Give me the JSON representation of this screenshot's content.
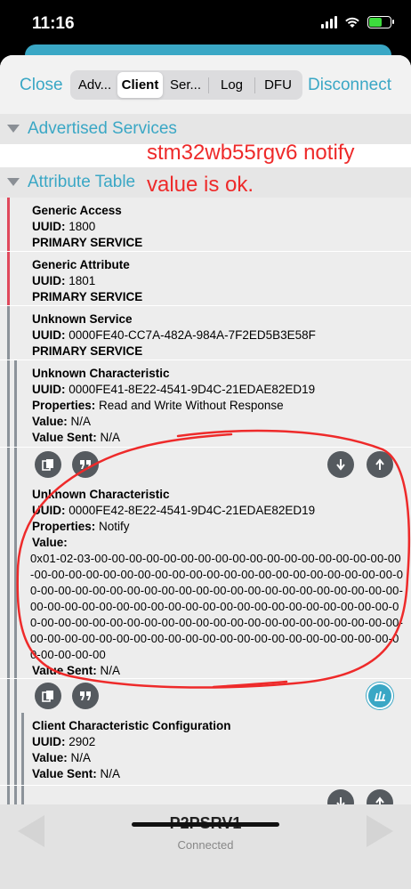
{
  "status_bar": {
    "time": "11:16"
  },
  "topbar": {
    "close_label": "Close",
    "disconnect_label": "Disconnect",
    "tabs": [
      {
        "label": "Adv..."
      },
      {
        "label": "Client"
      },
      {
        "label": "Ser..."
      },
      {
        "label": "Log"
      },
      {
        "label": "DFU"
      }
    ],
    "active_tab": "Client"
  },
  "sections": {
    "advertised": "Advertised Services",
    "attribute_table": "Attribute Table"
  },
  "annotation": {
    "line1": "stm32wb55rgv6 notify",
    "line2": "value is ok."
  },
  "rows": [
    {
      "name": "Generic Access",
      "uuid_label": "UUID:",
      "uuid": "1800",
      "kind": "PRIMARY SERVICE"
    },
    {
      "name": "Generic Attribute",
      "uuid_label": "UUID:",
      "uuid": "1801",
      "kind": "PRIMARY SERVICE"
    },
    {
      "name": "Unknown Service",
      "uuid_label": "UUID:",
      "uuid": "0000FE40-CC7A-482A-984A-7F2ED5B3E58F",
      "kind": "PRIMARY SERVICE"
    },
    {
      "name": "Unknown Characteristic",
      "uuid_label": "UUID:",
      "uuid": "0000FE41-8E22-4541-9D4C-21EDAE82ED19",
      "props_label": "Properties:",
      "props": "Read and Write Without Response",
      "value_label": "Value:",
      "value": "N/A",
      "sent_label": "Value Sent:",
      "sent": "N/A"
    },
    {
      "name": "Unknown Characteristic",
      "uuid_label": "UUID:",
      "uuid": "0000FE42-8E22-4541-9D4C-21EDAE82ED19",
      "props_label": "Properties:",
      "props": "Notify",
      "value_label": "Value:",
      "value": "0x01-02-03-00-00-00-00-00-00-00-00-00-00-00-00-00-00-00-00-00-00-00-00-00-00-00-00-00-00-00-00-00-00-00-00-00-00-00-00-00-00-00-00-00-00-00-00-00-00-00-00-00-00-00-00-00-00-00-00-00-00-00-00-00-00-00-00-00-00-00-00-00-00-00-00-00-00-00-00-00-00-00-00-00-00-00-00-00-00-00-00-00-00-00-00-00-00-00-00-00-00-00-00-00-00-00-00-00-00-00-00-00-00-00-00-00-00-00-00-00-00-00-00-00-00-00-00-00-00-00-00-00-00",
      "sent_label": "Value Sent:",
      "sent": "N/A"
    },
    {
      "name": "Client Characteristic Configuration",
      "uuid_label": "UUID:",
      "uuid": "2902",
      "value_label": "Value:",
      "value": "N/A",
      "sent_label": "Value Sent:",
      "sent": "N/A"
    }
  ],
  "bottom": {
    "device_name": "P2PSRV1",
    "status": "Connected"
  },
  "colors": {
    "accent": "#3aa7c5",
    "service_bar": "#e0495c",
    "char_bar": "#8c939a",
    "annotation": "#ee2a2a"
  }
}
